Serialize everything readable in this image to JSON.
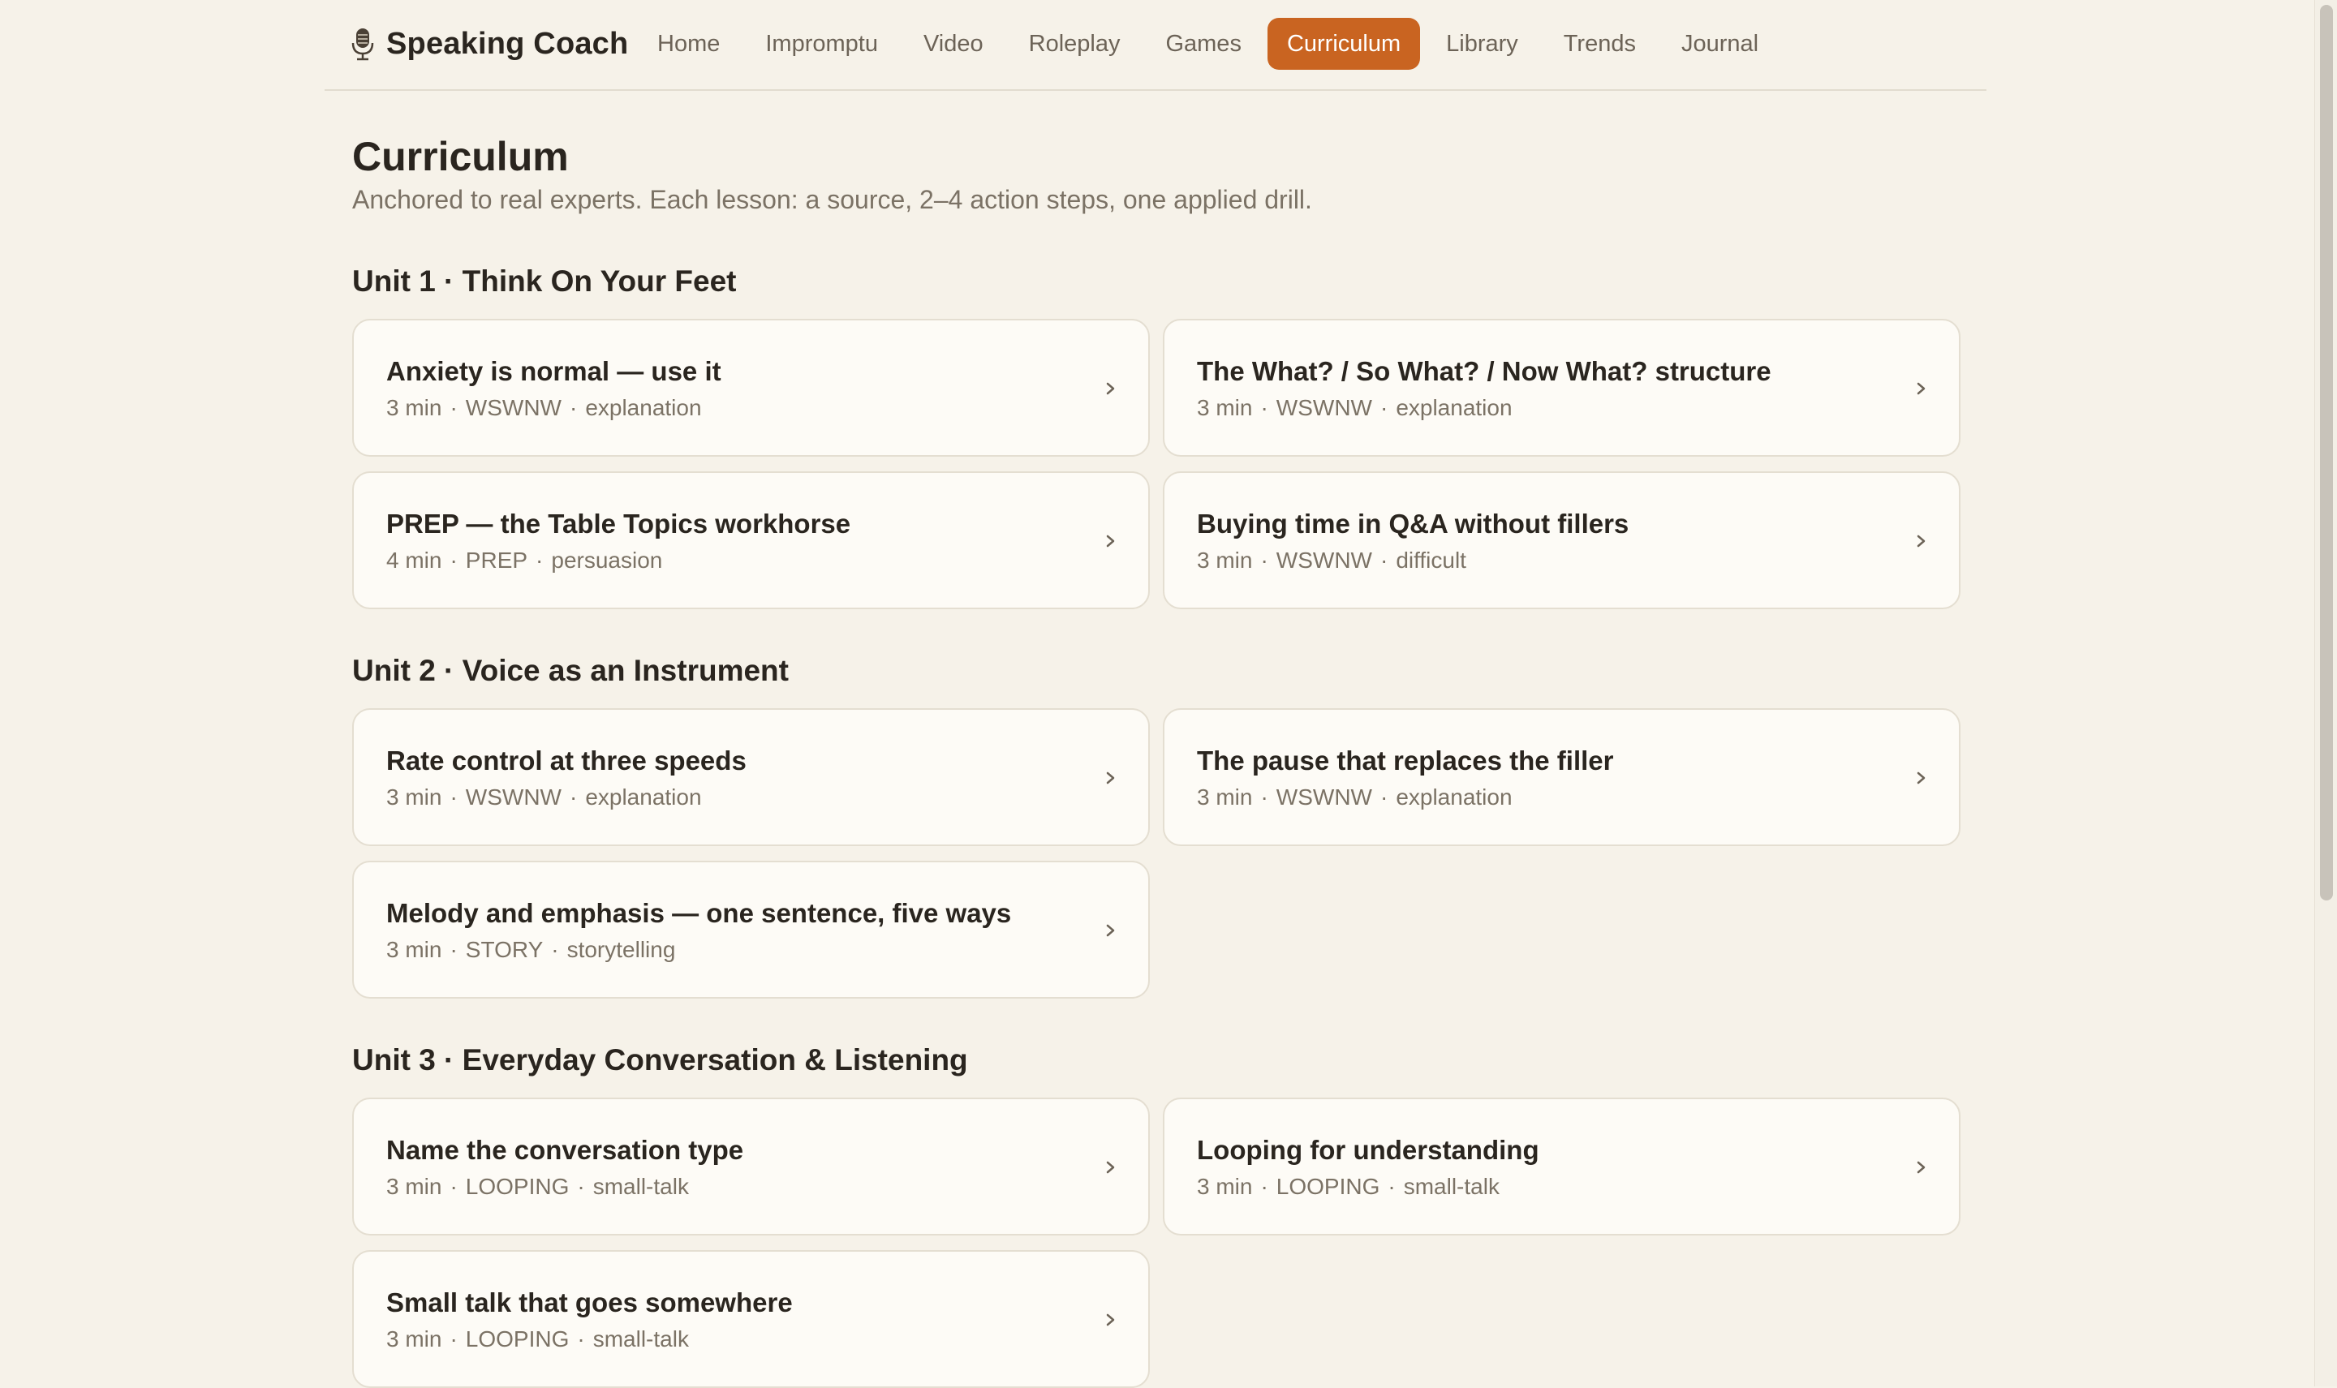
{
  "app": {
    "title": "Speaking Coach",
    "brand_icon": "microphone-icon",
    "accent_color": "#c96421"
  },
  "nav": {
    "items": [
      {
        "label": "Home"
      },
      {
        "label": "Impromptu"
      },
      {
        "label": "Video"
      },
      {
        "label": "Roleplay"
      },
      {
        "label": "Games"
      },
      {
        "label": "Curriculum",
        "active": true
      },
      {
        "label": "Library"
      },
      {
        "label": "Trends"
      },
      {
        "label": "Journal"
      }
    ]
  },
  "page": {
    "title": "Curriculum",
    "subtitle": "Anchored to real experts. Each lesson: a source, 2–4 action steps, one applied drill."
  },
  "units": [
    {
      "title": "Unit 1 · Think On Your Feet",
      "lessons": [
        {
          "title": "Anxiety is normal — use it",
          "duration": "3 min",
          "source": "WSWNW",
          "tag": "explanation"
        },
        {
          "title": "The What? / So What? / Now What? structure",
          "duration": "3 min",
          "source": "WSWNW",
          "tag": "explanation"
        },
        {
          "title": "PREP — the Table Topics workhorse",
          "duration": "4 min",
          "source": "PREP",
          "tag": "persuasion"
        },
        {
          "title": "Buying time in Q&A without fillers",
          "duration": "3 min",
          "source": "WSWNW",
          "tag": "difficult"
        }
      ]
    },
    {
      "title": "Unit 2 · Voice as an Instrument",
      "lessons": [
        {
          "title": "Rate control at three speeds",
          "duration": "3 min",
          "source": "WSWNW",
          "tag": "explanation"
        },
        {
          "title": "The pause that replaces the filler",
          "duration": "3 min",
          "source": "WSWNW",
          "tag": "explanation"
        },
        {
          "title": "Melody and emphasis — one sentence, five ways",
          "duration": "3 min",
          "source": "STORY",
          "tag": "storytelling"
        }
      ]
    },
    {
      "title": "Unit 3 · Everyday Conversation & Listening",
      "lessons": [
        {
          "title": "Name the conversation type",
          "duration": "3 min",
          "source": "LOOPING",
          "tag": "small-talk"
        },
        {
          "title": "Looping for understanding",
          "duration": "3 min",
          "source": "LOOPING",
          "tag": "small-talk"
        },
        {
          "title": "Small talk that goes somewhere",
          "duration": "3 min",
          "source": "LOOPING",
          "tag": "small-talk"
        }
      ]
    }
  ],
  "icons": {
    "chevron": "chevron-right-icon"
  }
}
